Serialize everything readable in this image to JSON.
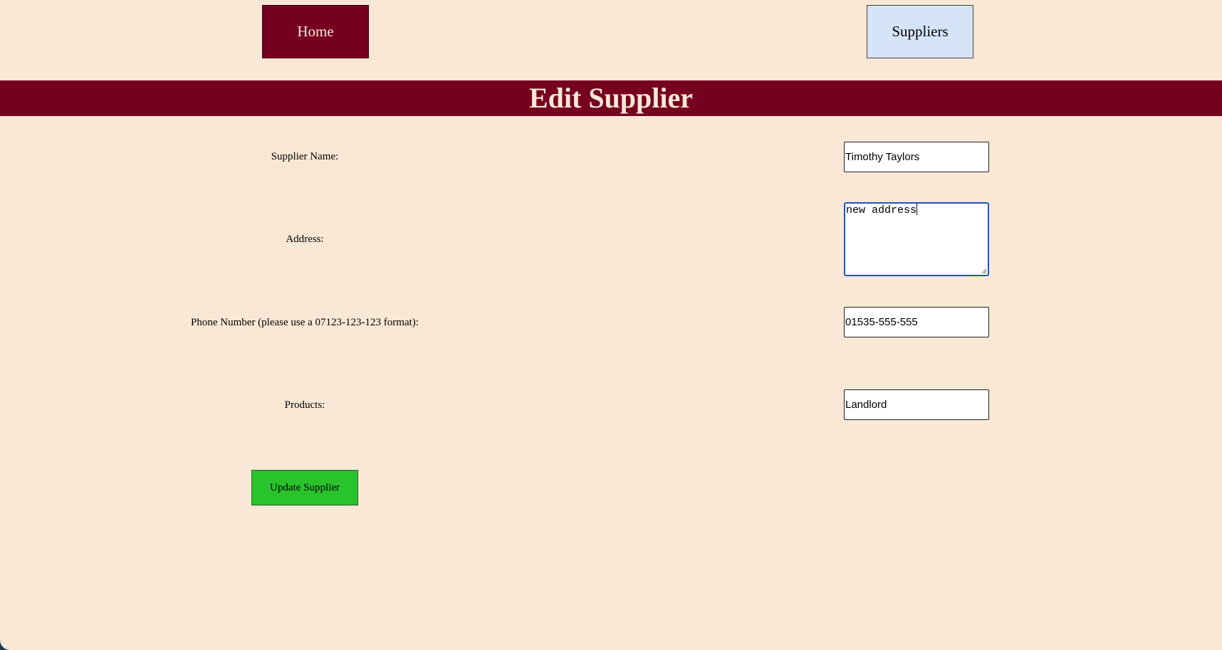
{
  "nav": {
    "home_label": "Home",
    "suppliers_label": "Suppliers"
  },
  "header": {
    "title": "Edit Supplier"
  },
  "form": {
    "supplier_name": {
      "label": "Supplier Name:",
      "value": "Timothy Taylors"
    },
    "address": {
      "label": "Address:",
      "value": "new address"
    },
    "phone": {
      "label": "Phone Number (please use a 07123-123-123 format):",
      "value": "01535-555-555"
    },
    "products": {
      "label": "Products:",
      "value": "Landlord"
    },
    "submit_label": "Update Supplier"
  },
  "colors": {
    "page_background": "#f8e8d5",
    "accent_maroon": "#760020",
    "suppliers_button": "#d6e4f8",
    "submit_button": "#29c42b",
    "focus_border": "#1a56c4"
  }
}
